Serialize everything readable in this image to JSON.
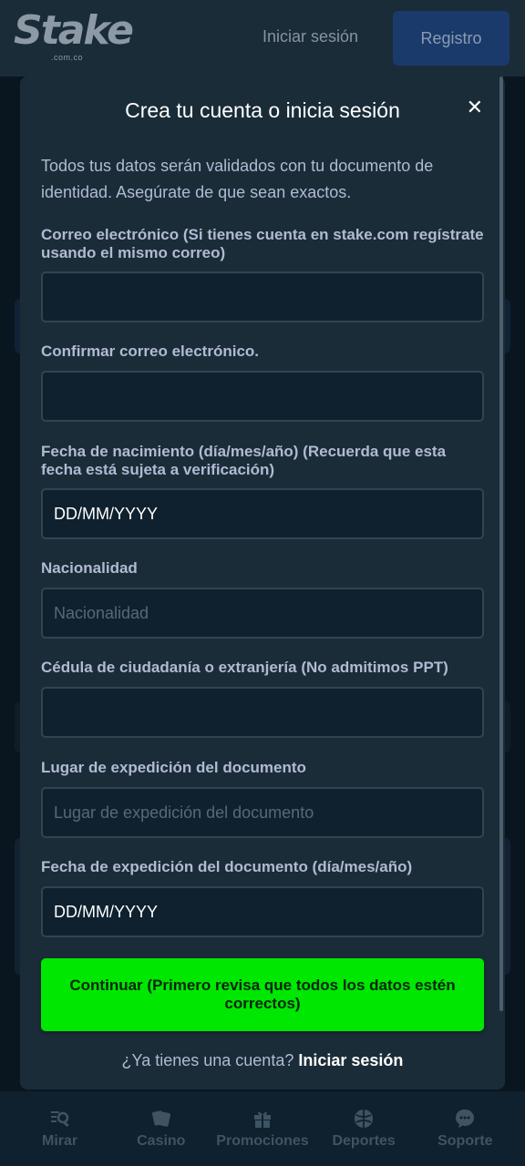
{
  "header": {
    "logo_text": "Stake",
    "logo_sub": ".com.co",
    "login_label": "Iniciar sesión",
    "register_label": "Registro"
  },
  "modal": {
    "title": "Crea tu cuenta o inicia sesión",
    "close_icon": "close-icon",
    "intro": "Todos tus datos serán validados con tu documento de identidad. Asegúrate de que sean exactos.",
    "fields": [
      {
        "label": "Correo electrónico (Si tienes cuenta en stake.com regístrate usando el mismo correo)",
        "value": "",
        "placeholder": ""
      },
      {
        "label": "Confirmar correo electrónico.",
        "value": "",
        "placeholder": ""
      },
      {
        "label": "Fecha de nacimiento (día/mes/año) (Recuerda que esta fecha está sujeta a verificación)",
        "value": "",
        "placeholder": "DD/MM/YYYY"
      },
      {
        "label": "Nacionalidad",
        "value": "",
        "placeholder": "Nacionalidad"
      },
      {
        "label": "Cédula de ciudadanía o extranjería (No admitimos PPT)",
        "value": "",
        "placeholder": ""
      },
      {
        "label": "Lugar de expedición del documento",
        "value": "",
        "placeholder": "Lugar de expedición del documento"
      },
      {
        "label": "Fecha de expedición del documento (día/mes/año)",
        "value": "",
        "placeholder": "DD/MM/YYYY"
      }
    ],
    "continue_label": "Continuar (Primero revisa que todos los datos estén correctos)",
    "footer_question": "¿Ya tienes una cuenta?",
    "footer_login": "Iniciar sesión"
  },
  "bottom_nav": {
    "items": [
      {
        "label": "Mirar",
        "icon": "watch-icon"
      },
      {
        "label": "Casino",
        "icon": "cards-icon"
      },
      {
        "label": "Promociones",
        "icon": "gift-icon"
      },
      {
        "label": "Deportes",
        "icon": "ball-icon"
      },
      {
        "label": "Soporte",
        "icon": "chat-icon"
      }
    ]
  },
  "colors": {
    "background": "#0f212e",
    "modal": "#1a2c38",
    "accent_green": "#00e701",
    "register_blue": "#1a3a6b"
  }
}
